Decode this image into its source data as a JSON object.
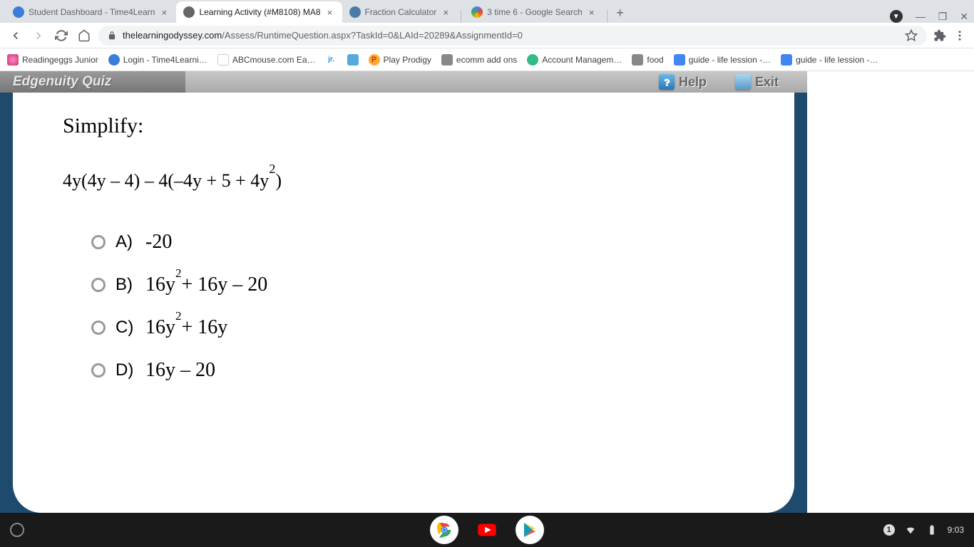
{
  "tabs": [
    {
      "title": "Student Dashboard - Time4Learn",
      "close": "×"
    },
    {
      "title": "Learning Activity (#M8108) MA8",
      "close": "×"
    },
    {
      "title": "Fraction Calculator",
      "close": "×"
    },
    {
      "title": "3 time 6 - Google Search",
      "close": "×"
    }
  ],
  "newTab": "+",
  "winControls": {
    "min": "—",
    "max": "❐",
    "close": "✕"
  },
  "circleStatus": "▼",
  "url": {
    "domain": "thelearningodyssey.com",
    "path": "/Assess/RuntimeQuestion.aspx?TaskId=0&LAId=20289&AssignmentId=0"
  },
  "bookmarks": [
    "Readingeggs Junior",
    "Login - Time4Learni…",
    "ABCmouse.com Ea…",
    "jr.",
    "",
    "Play Prodigy",
    "ecomm add ons",
    "Account Managem…",
    "food",
    "guide - life lession -…",
    "guide - life lession -…"
  ],
  "quiz": {
    "title": "Edgenuity Quiz",
    "help": "Help",
    "helpGlyph": "?",
    "exit": "Exit",
    "prompt": "Simplify:",
    "expression": {
      "pre": "4y(4y – 4) – 4(–4y + 5 + 4y",
      "sup": "2",
      "post": " )"
    },
    "answers": [
      {
        "label": "A)",
        "pre": "-20",
        "sup": "",
        "post": ""
      },
      {
        "label": "B)",
        "pre": "16y",
        "sup": "2",
        "post": " + 16y – 20"
      },
      {
        "label": "C)",
        "pre": "16y",
        "sup": "2",
        "post": " + 16y"
      },
      {
        "label": "D)",
        "pre": "16y – 20",
        "sup": "",
        "post": ""
      }
    ]
  },
  "taskbar": {
    "time": "9:03",
    "badge": "1"
  }
}
